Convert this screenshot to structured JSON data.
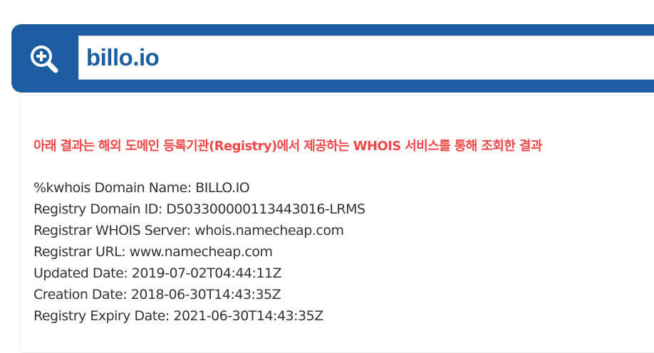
{
  "search": {
    "value": "billo.io",
    "icon": "zoom-in-search-icon",
    "bar_color": "#1c5ea1"
  },
  "result": {
    "notice": "아래 결과는 해외 도메인 등록기관(Registry)에서 제공하는 WHOIS 서비스를 통해 조회한 결과",
    "notice_color": "#f04848",
    "lines": [
      "%kwhois Domain Name: BILLO.IO",
      "Registry Domain ID: D503300000113443016-LRMS",
      "Registrar WHOIS Server: whois.namecheap.com",
      "Registrar URL: www.namecheap.com",
      "Updated Date: 2019-07-02T04:44:11Z",
      "Creation Date: 2018-06-30T14:43:35Z",
      "Registry Expiry Date: 2021-06-30T14:43:35Z"
    ]
  }
}
